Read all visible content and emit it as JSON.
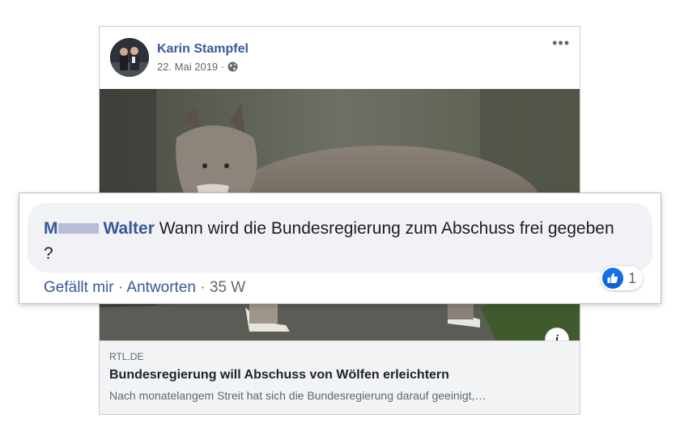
{
  "post": {
    "author": "Karin Stampfel",
    "date": "22. Mai 2019 ·",
    "more_label": "•••",
    "info_label": "i",
    "link": {
      "domain": "RTL.DE",
      "title": "Bundesregierung will Abschuss von Wölfen erleichtern",
      "description": "Nach monatelangem Streit hat sich die Bundesregierung darauf geeinigt,…"
    }
  },
  "comment": {
    "name_first": "M",
    "name_last": "Walter",
    "text": "Wann wird die Bundesregierung zum Abschuss frei gegeben ?",
    "like_label": "Gefällt mir",
    "reply_label": "Antworten",
    "separator": "·",
    "time": "35 W",
    "reaction_count": "1"
  },
  "colors": {
    "link_blue": "#385898",
    "like_blue": "#1877f2",
    "bubble_bg": "#f0f2f5"
  },
  "icons": {
    "privacy": "globe-icon",
    "reaction": "like-icon",
    "menu": "more-icon",
    "info": "info-icon"
  }
}
